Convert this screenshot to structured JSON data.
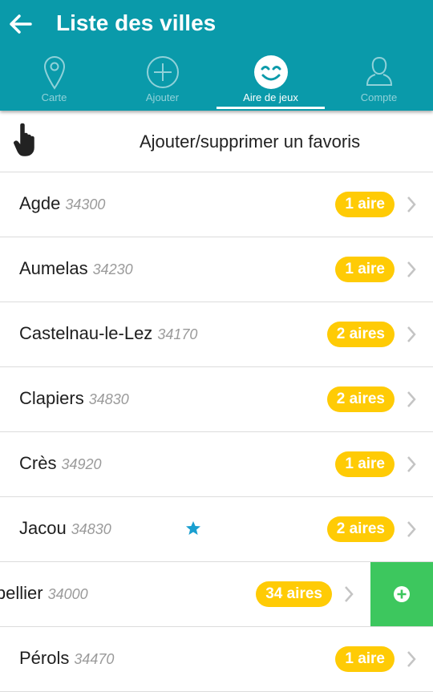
{
  "header": {
    "title": "Liste des villes"
  },
  "tabs": [
    {
      "label": "Carte",
      "icon": "location-pin-icon"
    },
    {
      "label": "Ajouter",
      "icon": "plus-circle-icon"
    },
    {
      "label": "Aire de jeux",
      "icon": "smiley-icon",
      "active": true
    },
    {
      "label": "Compte",
      "icon": "user-icon"
    }
  ],
  "favorites_row": {
    "label": "Ajouter/supprimer un favoris",
    "icon": "hand-pointer-icon"
  },
  "cities": [
    {
      "name": "Agde",
      "zip": "34300",
      "badge": "1 aire"
    },
    {
      "name": "Aumelas",
      "zip": "34230",
      "badge": "1 aire"
    },
    {
      "name": "Castelnau-le-Lez",
      "zip": "34170",
      "badge": "2 aires"
    },
    {
      "name": "Clapiers",
      "zip": "34830",
      "badge": "2 aires"
    },
    {
      "name": "Crès",
      "zip": "34920",
      "badge": "1 aire"
    },
    {
      "name": "Jacou",
      "zip": "34830",
      "badge": "2 aires",
      "favorite": true
    },
    {
      "name": "Montpellier",
      "zip": "34000",
      "badge": "34 aires",
      "swiped": true
    },
    {
      "name": "Pérols",
      "zip": "34470",
      "badge": "1 aire"
    }
  ],
  "colors": {
    "primary": "#0a9aaa",
    "badge": "#ffcb05",
    "favorite_star": "#1a9fd0",
    "add_action": "#3dc75e"
  }
}
